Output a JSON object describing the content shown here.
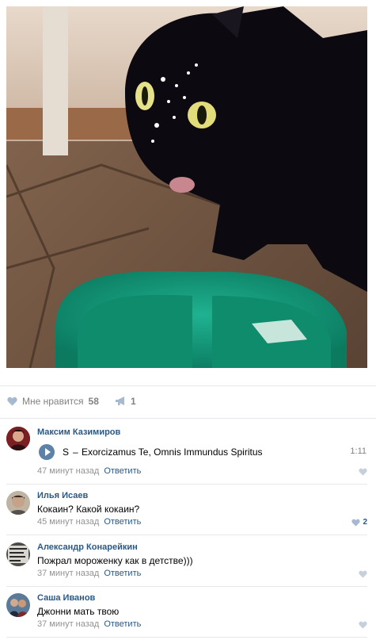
{
  "post": {
    "photo_alt": "",
    "likes_label": "Мне нравится",
    "likes_count": "58",
    "shares_count": "1"
  },
  "comments": [
    {
      "author": "Максим Казимиров",
      "audio": {
        "artist": "S",
        "dash": "–",
        "title": "Exorcizamus Te, Omnis Immundus Spiritus",
        "duration": "1:11"
      },
      "time": "47 минут назад",
      "reply": "Ответить",
      "likes": ""
    },
    {
      "author": "Илья Исаев",
      "text": "Кокаин? Какой кокаин?",
      "time": "45 минут назад",
      "reply": "Ответить",
      "likes": "2"
    },
    {
      "author": "Александр Конарейкин",
      "text": "Пожрал мороженку как в детстве)))",
      "time": "37 минут назад",
      "reply": "Ответить",
      "likes": ""
    },
    {
      "author": "Саша Иванов",
      "text": "Джонни мать твою",
      "time": "37 минут назад",
      "reply": "Ответить",
      "likes": ""
    }
  ],
  "colors": {
    "link": "#2a5885",
    "meta": "#939393",
    "heart": "#a6b9cf"
  }
}
